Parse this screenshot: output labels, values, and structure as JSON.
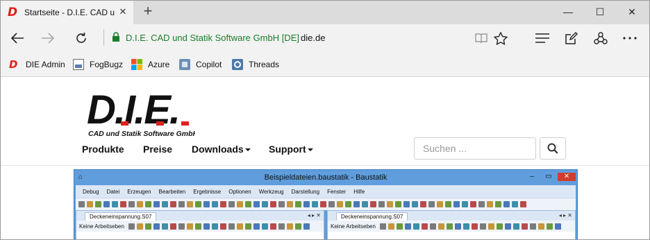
{
  "browser": {
    "tab": {
      "title": "Startseite - D.I.E. CAD u"
    },
    "window_controls": {
      "minimize": "—",
      "maximize": "☐",
      "close": "✕"
    }
  },
  "address": {
    "site_identity": "D.I.E. CAD und Statik Software GmbH [DE]",
    "url": "die.de"
  },
  "favorites": [
    {
      "label": "DIE Admin",
      "icon": "die-logo-icon"
    },
    {
      "label": "FogBugz",
      "icon": "fogbugz-icon"
    },
    {
      "label": "Azure",
      "icon": "azure-windows-icon"
    },
    {
      "label": "Copilot",
      "icon": "copilot-icon"
    },
    {
      "label": "Threads",
      "icon": "threads-icon"
    }
  ],
  "site": {
    "logo_text": "D.I.E.",
    "logo_subtitle": "CAD und Statik Software GmbH",
    "nav": [
      {
        "label": "Produkte",
        "dropdown": false
      },
      {
        "label": "Preise",
        "dropdown": false
      },
      {
        "label": "Downloads",
        "dropdown": true
      },
      {
        "label": "Support",
        "dropdown": true
      }
    ],
    "search": {
      "placeholder": "Suchen ..."
    }
  },
  "app_screenshot": {
    "title": "Beispieldateien.baustatik - Baustatik",
    "menu": [
      "Debug",
      "Datei",
      "Erzeugen",
      "Bearbeiten",
      "Ergebnisse",
      "Optionen",
      "Werkzeug",
      "Darstellung",
      "Fenster",
      "Hilfe"
    ],
    "panes": [
      {
        "tab": "Deckeneinspannung.S07",
        "combo": "Keine Arbeitseben"
      },
      {
        "tab": "Deckeneinspannung.S07",
        "combo": "Keine Arbeitseben"
      }
    ]
  },
  "colors": {
    "accent_red": "#e0201b",
    "secure_green": "#1a7d2c",
    "app_titlebar": "#5f9ddc"
  }
}
